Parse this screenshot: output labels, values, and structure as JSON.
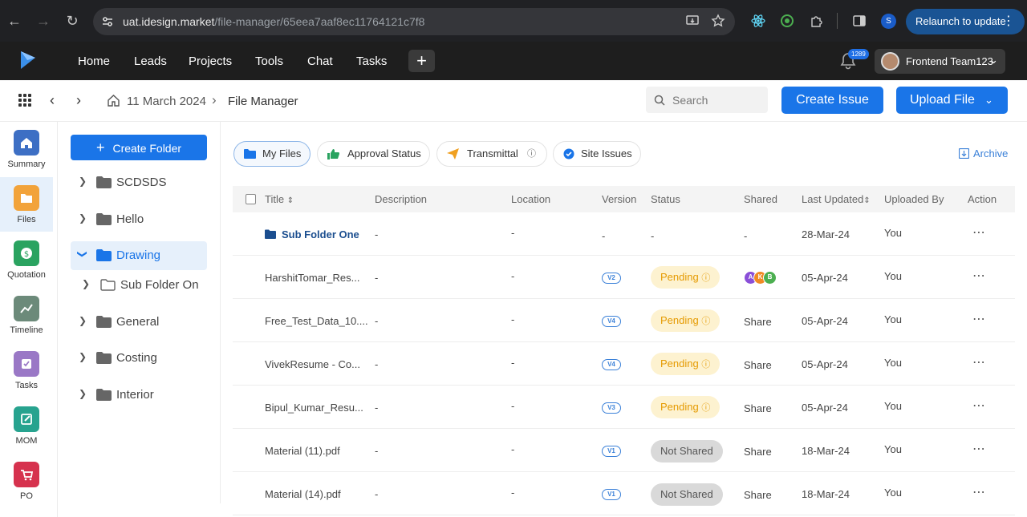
{
  "browser": {
    "url_host": "uat.idesign.market",
    "url_path": "/file-manager/65eea7aaf8ec11764121c7f8",
    "profile_initial": "S",
    "relaunch_label": "Relaunch to update"
  },
  "appbar": {
    "nav": [
      "Home",
      "Leads",
      "Projects",
      "Tools",
      "Chat",
      "Tasks"
    ],
    "plus_label": "+",
    "notification_count": "1289",
    "user_name": "Frontend Team123"
  },
  "breadcrumb": {
    "date": "11 March 2024",
    "current": "File Manager"
  },
  "search": {
    "placeholder": "Search"
  },
  "buttons": {
    "create_issue": "Create Issue",
    "upload_file": "Upload File",
    "create_folder": "Create Folder"
  },
  "rail": [
    {
      "label": "Summary",
      "color": "#3d6fc4"
    },
    {
      "label": "Files",
      "color": "#f2a33a"
    },
    {
      "label": "Quotation",
      "color": "#2aa360"
    },
    {
      "label": "Timeline",
      "color": "#6c8a7a"
    },
    {
      "label": "Tasks",
      "color": "#9a78c6"
    },
    {
      "label": "MOM",
      "color": "#27a38f"
    },
    {
      "label": "PO",
      "color": "#d6324e"
    }
  ],
  "tree": [
    {
      "name": "SCDSDS"
    },
    {
      "name": "Hello"
    },
    {
      "name": "Drawing"
    },
    {
      "name": "Sub Folder On"
    },
    {
      "name": "General"
    },
    {
      "name": "Costing"
    },
    {
      "name": "Interior"
    }
  ],
  "tabs": {
    "my_files": "My Files",
    "approval_status": "Approval Status",
    "transmittal": "Transmittal",
    "site_issues": "Site Issues",
    "archive": "Archive"
  },
  "table": {
    "headers": {
      "title": "Title",
      "description": "Description",
      "location": "Location",
      "version": "Version",
      "status": "Status",
      "shared": "Shared",
      "last_updated": "Last Updated",
      "uploaded_by": "Uploaded By",
      "action": "Action"
    },
    "rows": [
      {
        "title": "Sub Folder One",
        "description": "-",
        "location": "-",
        "version": "-",
        "status": "-",
        "shared": "-",
        "updated": "28-Mar-24",
        "by": "You"
      },
      {
        "title": "HarshitTomar_Res...",
        "description": "-",
        "location": "-",
        "version": "V2",
        "status": "Pending",
        "shared": "",
        "avatars": [
          "A",
          "K",
          "B"
        ],
        "updated": "05-Apr-24",
        "by": "You"
      },
      {
        "title": "Free_Test_Data_10....",
        "description": "-",
        "location": "-",
        "version": "V4",
        "status": "Pending",
        "shared": "Share",
        "updated": "05-Apr-24",
        "by": "You"
      },
      {
        "title": "VivekResume - Co...",
        "description": "-",
        "location": "-",
        "version": "V4",
        "status": "Pending",
        "shared": "Share",
        "updated": "05-Apr-24",
        "by": "You"
      },
      {
        "title": "Bipul_Kumar_Resu...",
        "description": "-",
        "location": "-",
        "version": "V3",
        "status": "Pending",
        "shared": "Share",
        "updated": "05-Apr-24",
        "by": "You"
      },
      {
        "title": "Material (11).pdf",
        "description": "-",
        "location": "-",
        "version": "V1",
        "status": "Not Shared",
        "shared": "Share",
        "updated": "18-Mar-24",
        "by": "You"
      },
      {
        "title": "Material (14).pdf",
        "description": "-",
        "location": "-",
        "version": "V1",
        "status": "Not Shared",
        "shared": "Share",
        "updated": "18-Mar-24",
        "by": "You"
      }
    ]
  },
  "colors": {
    "primary": "#1a75e8",
    "pending_bg": "#fdf2d0",
    "pending_text": "#e59a00",
    "not_shared_bg": "#d9d9d9"
  }
}
